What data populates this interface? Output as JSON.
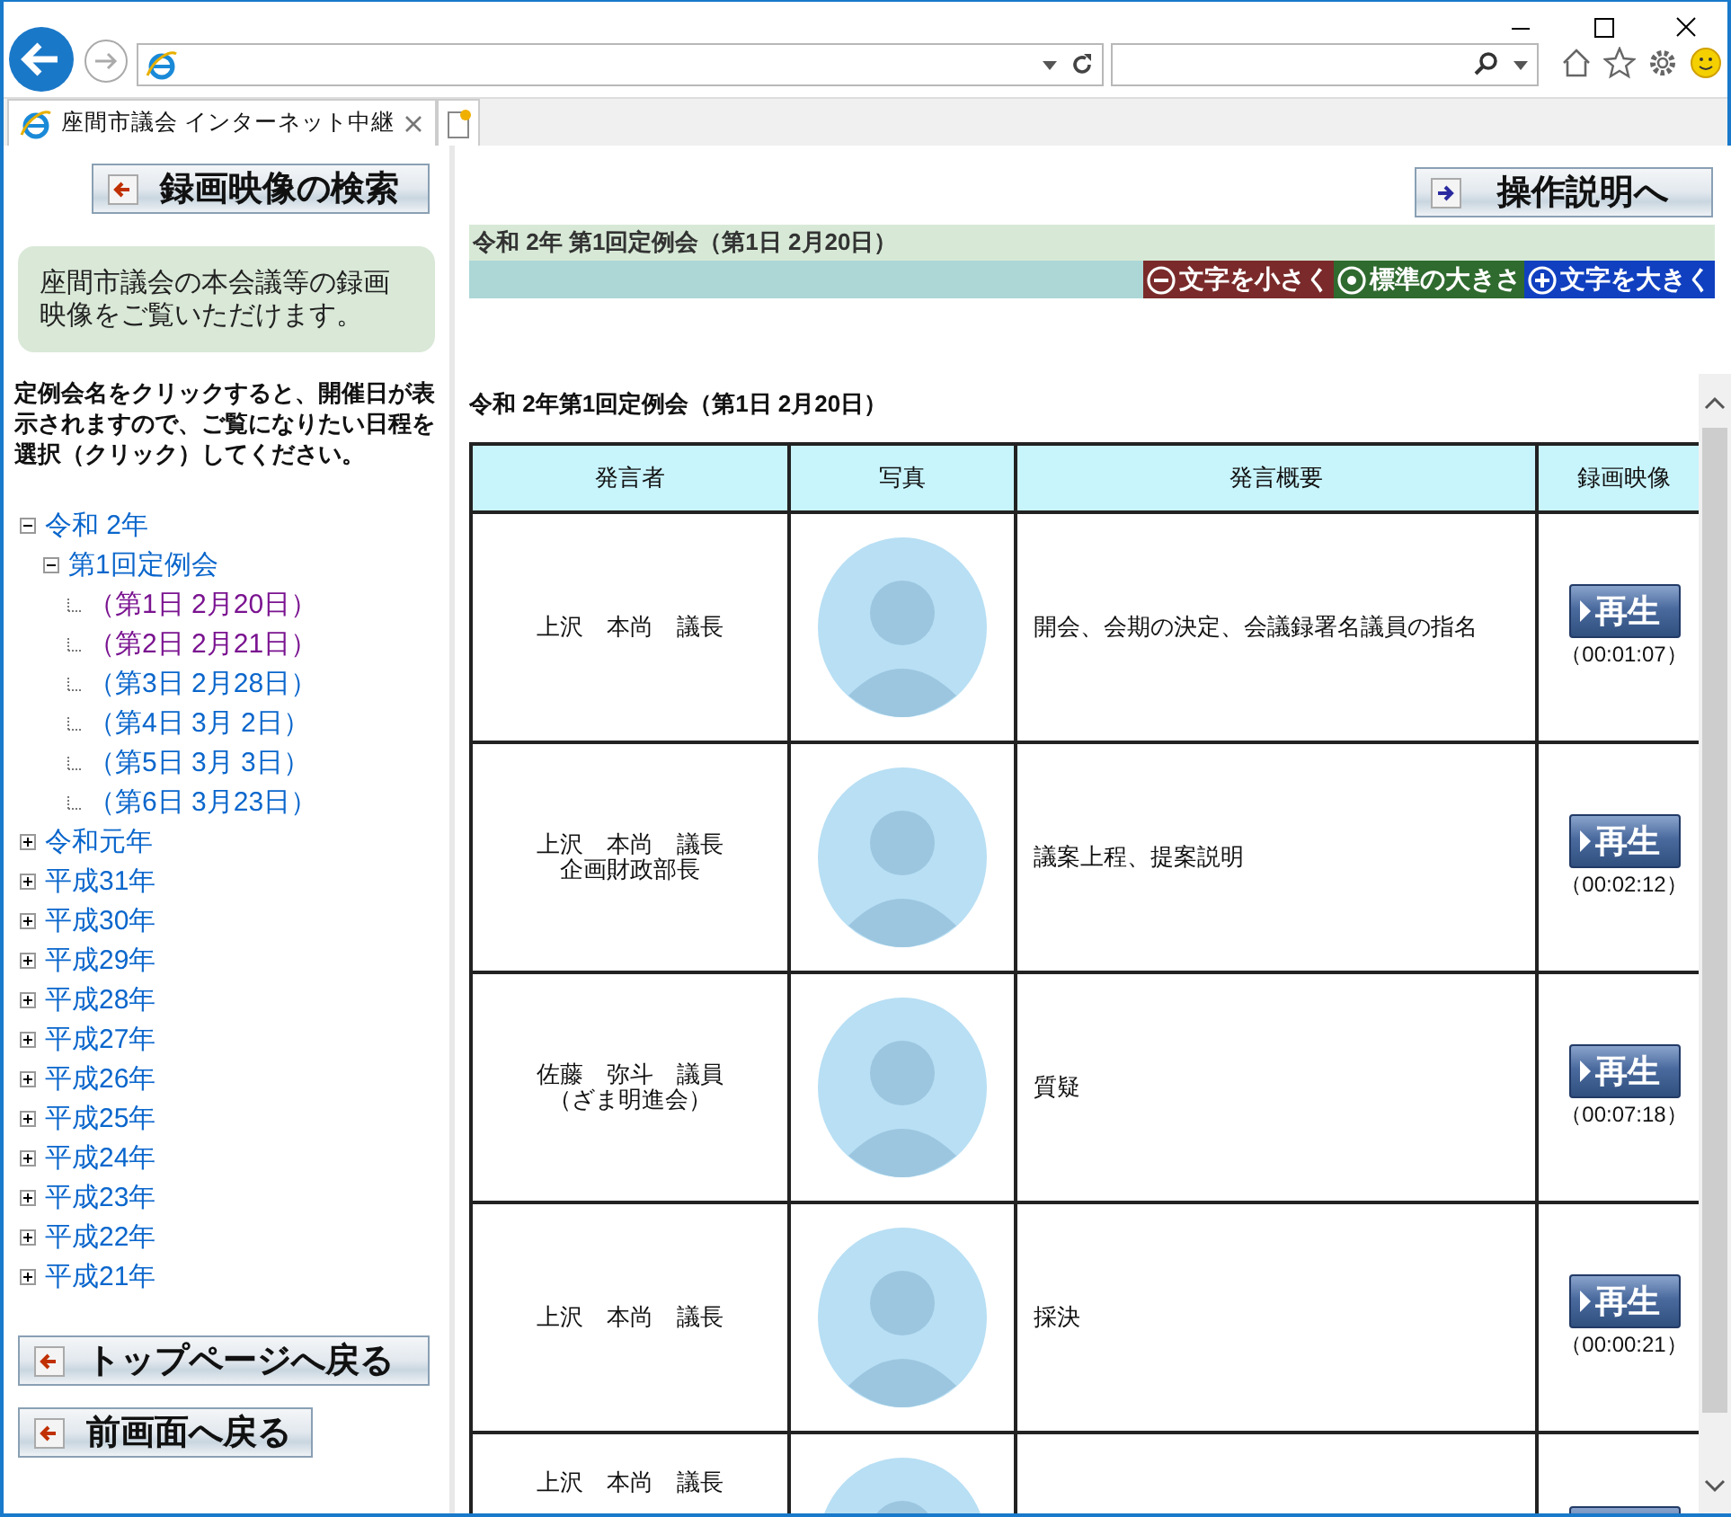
{
  "browser": {
    "tab_title": "座間市議会 インターネット中継"
  },
  "sidebar": {
    "search_button": "録画映像の検索",
    "intro": "座間市議会の本会議等の録画映像をご覧いただけます。",
    "instructions": "定例会名をクリックすると、開催日が表示されますので、ご覧になりたい日程を選択（クリック）してください。",
    "tree": [
      {
        "label": "令和 2年",
        "expanded": true,
        "children": [
          {
            "label": "第1回定例会",
            "expanded": true,
            "children": [
              {
                "label": "（第1日 2月20日）",
                "visited": true
              },
              {
                "label": "（第2日 2月21日）",
                "visited": true
              },
              {
                "label": "（第3日 2月28日）",
                "visited": false
              },
              {
                "label": "（第4日 3月 2日）",
                "visited": false
              },
              {
                "label": "（第5日 3月 3日）",
                "visited": false
              },
              {
                "label": "（第6日 3月23日）",
                "visited": false
              }
            ]
          }
        ]
      },
      {
        "label": "令和元年",
        "expanded": false
      },
      {
        "label": "平成31年",
        "expanded": false
      },
      {
        "label": "平成30年",
        "expanded": false
      },
      {
        "label": "平成29年",
        "expanded": false
      },
      {
        "label": "平成28年",
        "expanded": false
      },
      {
        "label": "平成27年",
        "expanded": false
      },
      {
        "label": "平成26年",
        "expanded": false
      },
      {
        "label": "平成25年",
        "expanded": false
      },
      {
        "label": "平成24年",
        "expanded": false
      },
      {
        "label": "平成23年",
        "expanded": false
      },
      {
        "label": "平成22年",
        "expanded": false
      },
      {
        "label": "平成21年",
        "expanded": false
      }
    ],
    "buttons": [
      "トップページへ戻る",
      "前画面へ戻る"
    ]
  },
  "main": {
    "help_button": "操作説明へ",
    "session_title": "令和 2年 第1回定例会（第1日 2月20日）",
    "font_controls": [
      {
        "kind": "smaller",
        "label": "文字を小さく",
        "color": "#7a2a2a"
      },
      {
        "kind": "standard",
        "label": "標準の大きさ",
        "color": "#2f6a2f"
      },
      {
        "kind": "larger",
        "label": "文字を大きく",
        "color": "#1040c0"
      }
    ],
    "table_title": "令和 2年第1回定例会（第1日 2月20日）",
    "table": {
      "columns": [
        "発言者",
        "写真",
        "発言概要",
        "録画映像"
      ],
      "rows": [
        {
          "speaker": [
            "上沢　本尚　議長"
          ],
          "summary": "開会、会期の決定、会議録署名議員の指名",
          "play": "再生",
          "duration": "（00:01:07）"
        },
        {
          "speaker": [
            "上沢　本尚　議長",
            "企画財政部長"
          ],
          "summary": "議案上程、提案説明",
          "play": "再生",
          "duration": "（00:02:12）"
        },
        {
          "speaker": [
            "佐藤　弥斗　議員",
            "（ざま明進会）"
          ],
          "summary": "質疑",
          "play": "再生",
          "duration": "（00:07:18）"
        },
        {
          "speaker": [
            "上沢　本尚　議長"
          ],
          "summary": "採決",
          "play": "再生",
          "duration": "（00:00:21）"
        },
        {
          "speaker": [
            "上沢　本尚　議長"
          ]
        }
      ]
    }
  }
}
